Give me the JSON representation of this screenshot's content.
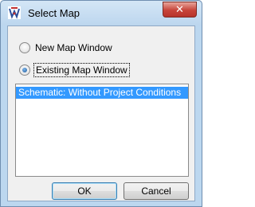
{
  "window": {
    "title": "Select Map",
    "close_label": "✕"
  },
  "options": [
    {
      "label": "New Map Window",
      "selected": false
    },
    {
      "label": "Existing Map Window",
      "selected": true
    }
  ],
  "map_list": {
    "items": [
      {
        "label": "Schematic: Without Project Conditions",
        "selected": true
      }
    ]
  },
  "buttons": {
    "ok_label": "OK",
    "cancel_label": "Cancel"
  },
  "colors": {
    "selection": "#3399ff",
    "titlebar": "#bcd6ee",
    "close_button": "#c7443a"
  },
  "icons": {
    "app": "app-logo-icon",
    "close": "close-icon"
  }
}
